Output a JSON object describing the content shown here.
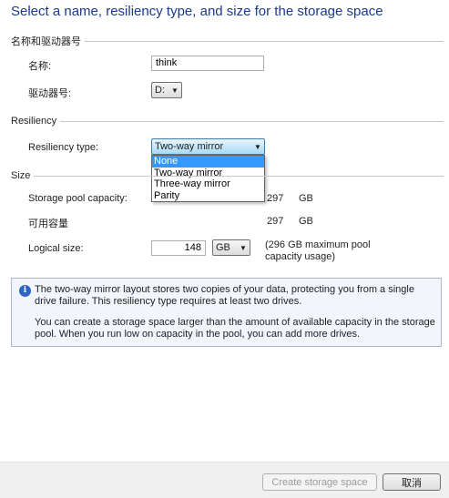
{
  "title": "Select a name, resiliency type, and size for the storage space",
  "sections": {
    "name_drive": "名称和驱动器号",
    "resiliency": "Resiliency",
    "size": "Size"
  },
  "name": {
    "label": "名称:",
    "value": "think"
  },
  "drive": {
    "label": "驱动器号:",
    "value": "D:"
  },
  "resiliency": {
    "label": "Resiliency type:",
    "selected": "Two-way mirror",
    "options": [
      "None",
      "Two-way mirror",
      "Three-way mirror",
      "Parity"
    ],
    "highlighted": "None"
  },
  "size": {
    "pool_capacity_label": "Storage pool capacity:",
    "pool_capacity_value": "297",
    "pool_capacity_unit": "GB",
    "available_label": "可用容量",
    "available_value": "297",
    "available_unit": "GB",
    "logical_label": "Logical size:",
    "logical_value": "148",
    "logical_unit": "GB",
    "max_note_line1": "(296 GB maximum pool",
    "max_note_line2": "capacity usage)"
  },
  "info": {
    "line1": "The two-way mirror layout stores two copies of your data, protecting you from a single",
    "line2": "drive failure. This resiliency type requires at least two drives.",
    "line3": "You can create a storage space larger than the amount of available capacity in the storage",
    "line4": "pool. When you run low on capacity in the pool, you can add more drives."
  },
  "buttons": {
    "create": "Create storage space",
    "cancel": "取消"
  }
}
